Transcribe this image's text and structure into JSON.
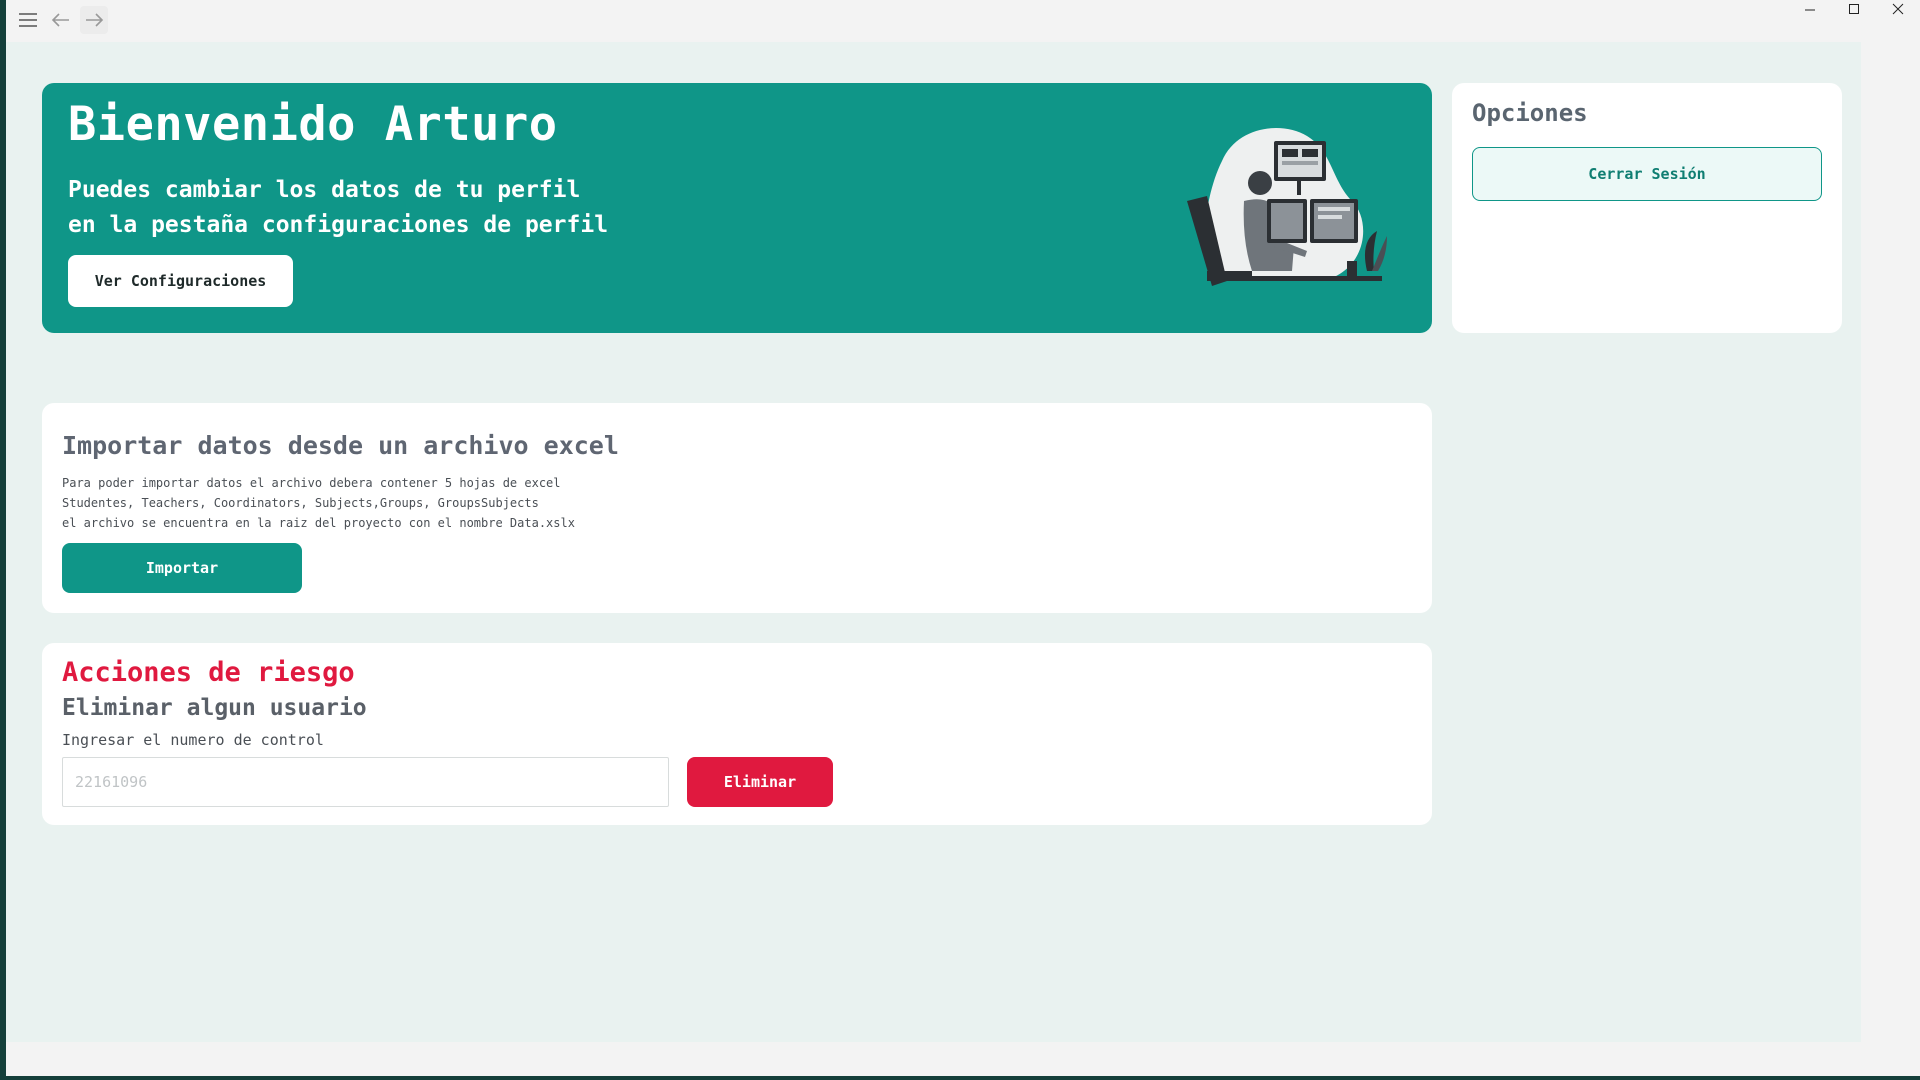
{
  "titlebar": {
    "menu_icon": "hamburger-icon",
    "back_icon": "arrow-left-icon",
    "forward_icon": "arrow-right-icon",
    "window_controls": [
      "minimize-icon",
      "maximize-icon",
      "close-icon"
    ]
  },
  "hero": {
    "title": "Bienvenido Arturo",
    "subtitle_line1": "Puedes cambiar los datos de tu perfil",
    "subtitle_line2": "en la pestaña configuraciones de perfil",
    "button_label": "Ver Configuraciones",
    "illustration": "developer-at-computer-illustration"
  },
  "options": {
    "title": "Opciones",
    "logout_label": "Cerrar Sesión"
  },
  "import": {
    "title": "Importar datos desde un archivo excel",
    "desc_line1": "Para poder importar datos el archivo debera contener 5 hojas de excel",
    "desc_line2": "Studentes, Teachers, Coordinators, Subjects,Groups, GroupsSubjects",
    "desc_line3": "el archivo se encuentra en la raiz del proyecto con el nombre Data.xslx",
    "button_label": "Importar"
  },
  "risk": {
    "title": "Acciones de riesgo",
    "subtitle": "Eliminar algun usuario",
    "label": "Ingresar el numero de control",
    "input_placeholder": "22161096",
    "input_value": "",
    "delete_label": "Eliminar"
  },
  "colors": {
    "primary": "#0f9688",
    "danger": "#e0193f",
    "background": "#e9f2f0",
    "card": "#ffffff"
  }
}
